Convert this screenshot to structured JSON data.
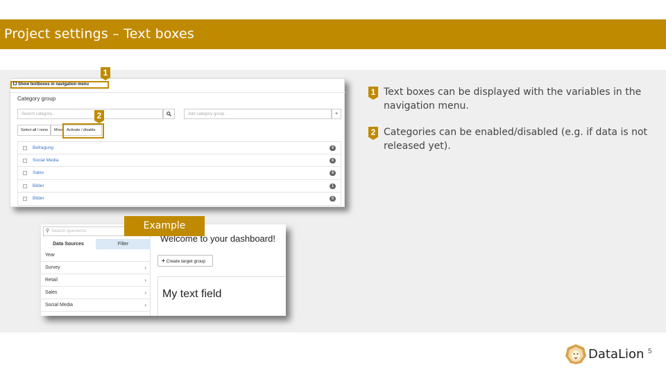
{
  "slide": {
    "title": "Project settings – Text boxes",
    "page_number": "5",
    "brand": "DataLion",
    "accent_color": "#c08a00"
  },
  "settings_panel": {
    "show_textboxes_label": "Show textboxes in navigation menu",
    "category_group_heading": "Category group",
    "search_placeholder": "Search category...",
    "search_icon": "search-icon",
    "add_placeholder": "Add category group",
    "add_label": "+",
    "buttons": {
      "select_all": "Select all / none",
      "move": "Move",
      "activate": "Activate / disable"
    },
    "categories": [
      {
        "name": "Befragung",
        "count": "4"
      },
      {
        "name": "Social Media",
        "count": "6"
      },
      {
        "name": "Sales",
        "count": "4"
      },
      {
        "name": "Bilder",
        "count": "1"
      },
      {
        "name": "Bilder",
        "count": "0"
      }
    ]
  },
  "markers": {
    "m1": "1",
    "m2": "2"
  },
  "example": {
    "tag": "Example",
    "search_placeholder": "Search questions",
    "tab_data_sources": "Data Sources",
    "tab_filter": "Filter",
    "items": [
      {
        "label": "Year",
        "chevron": ""
      },
      {
        "label": "Survey",
        "chevron": "›"
      },
      {
        "label": "Retail",
        "chevron": "›"
      },
      {
        "label": "Sales",
        "chevron": "›"
      },
      {
        "label": "Social Media",
        "chevron": "›"
      }
    ],
    "welcome": "Welcome to your dashboard!",
    "create_target_group": "Create target group",
    "text_field": "My text field"
  },
  "explanations": [
    {
      "number": "1",
      "text": "Text boxes can be displayed with the variables in the navigation menu."
    },
    {
      "number": "2",
      "text": "Categories can be enabled/disabled (e.g. if data is not released yet)."
    }
  ]
}
